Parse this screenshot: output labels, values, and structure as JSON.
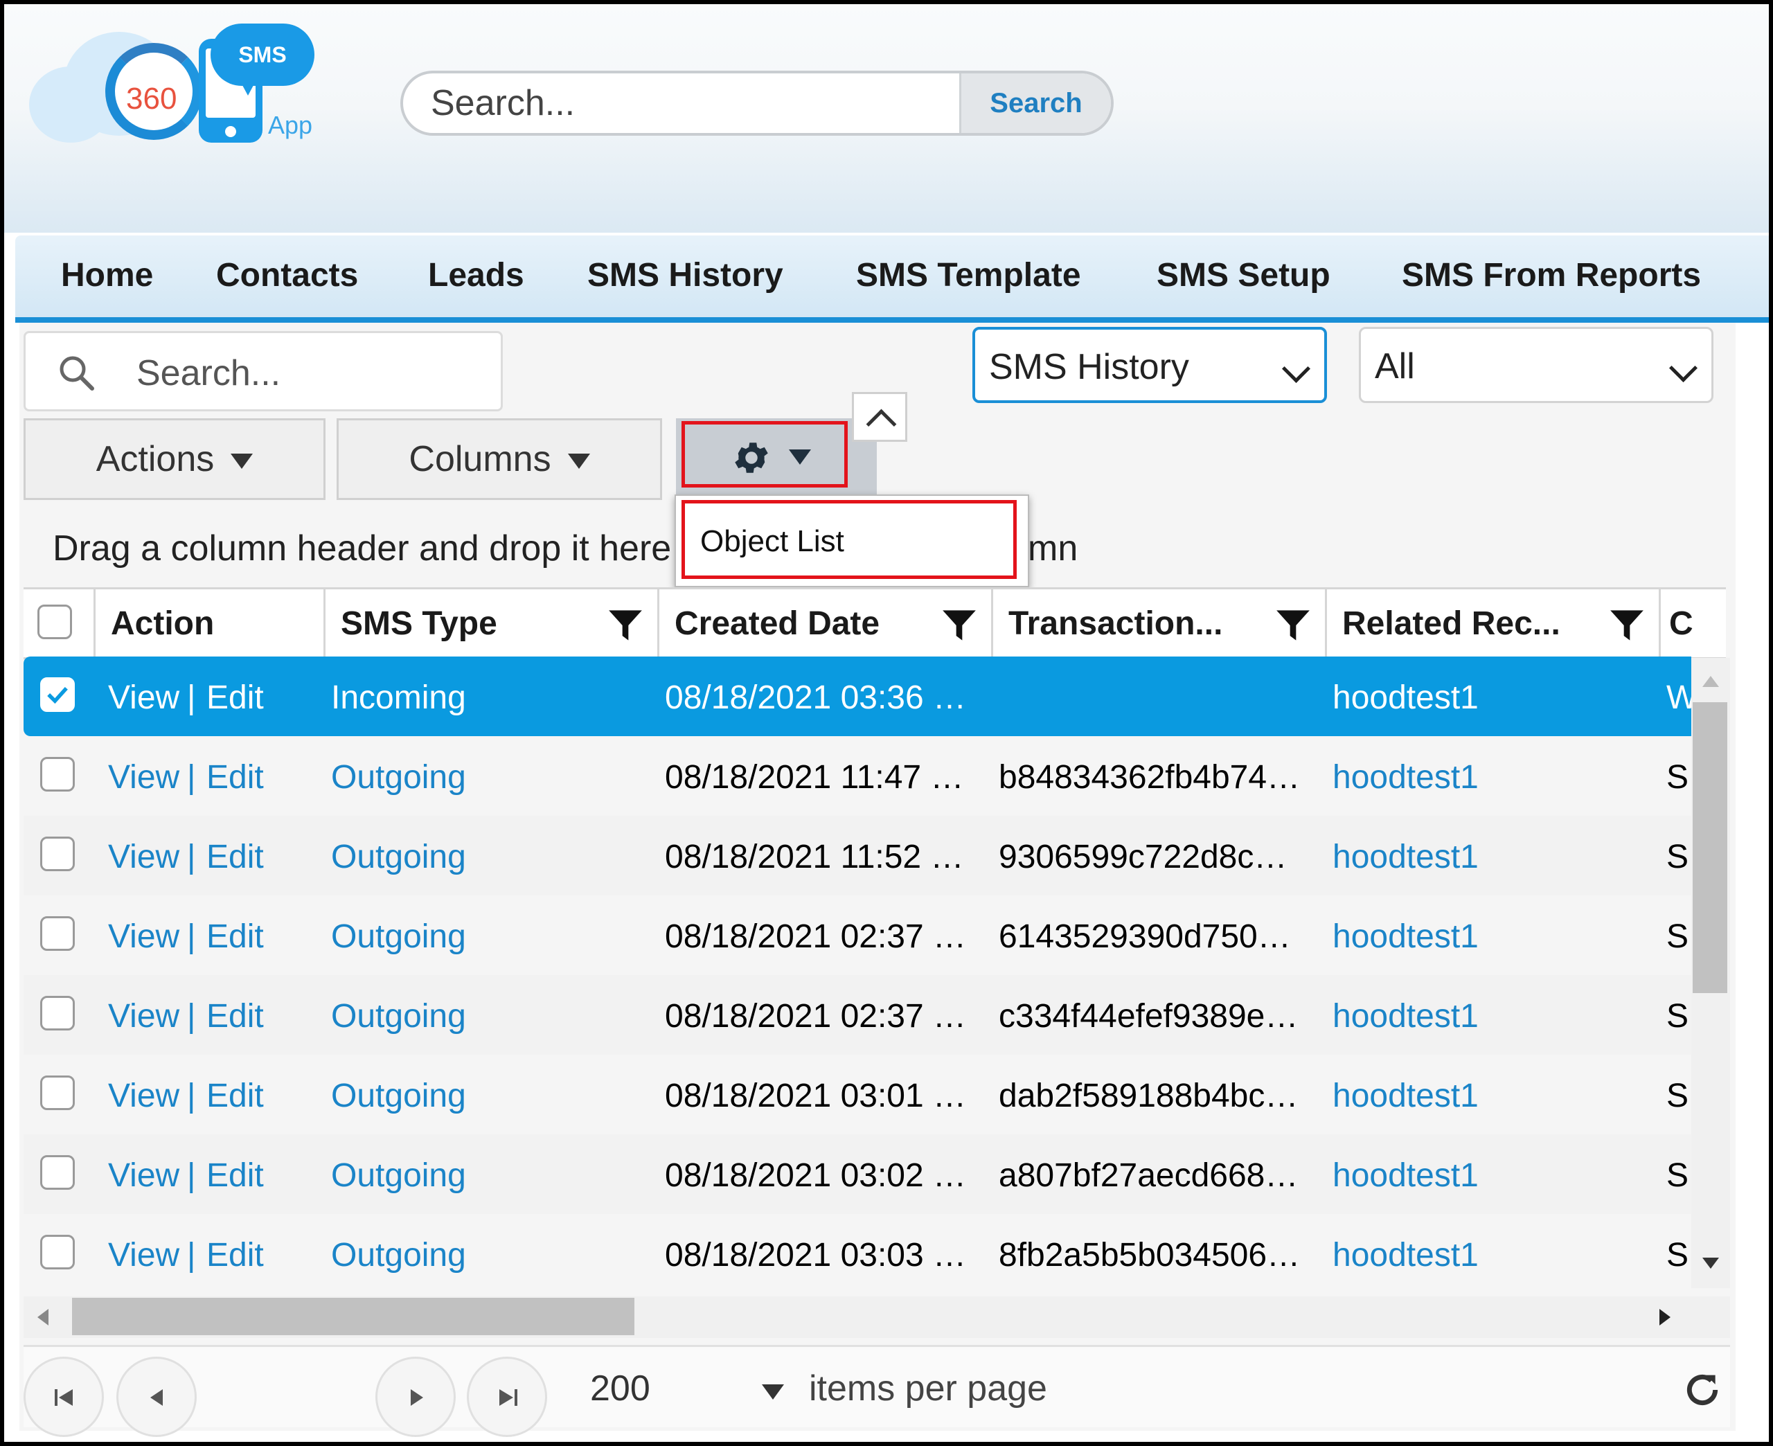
{
  "brand": {
    "bubble_text": "SMS",
    "badge_text": "360",
    "app_text": "App"
  },
  "global_search": {
    "placeholder": "Search...",
    "button_label": "Search"
  },
  "nav_tabs": [
    "Home",
    "Contacts",
    "Leads",
    "SMS History",
    "SMS Template",
    "SMS Setup",
    "SMS From Reports"
  ],
  "list_search": {
    "placeholder": "Search..."
  },
  "object_select": {
    "value": "SMS History"
  },
  "filter_select": {
    "value": "All"
  },
  "toolbar": {
    "actions_label": "Actions",
    "columns_label": "Columns"
  },
  "settings_menu": {
    "items": [
      "Object List"
    ]
  },
  "group_hint": {
    "before": "Drag a column header and drop it here",
    "after": "mn"
  },
  "columns": [
    "Action",
    "SMS Type",
    "Created Date",
    "Transaction...",
    "Related Rec...",
    "C"
  ],
  "rows": [
    {
      "view": "View",
      "edit": "Edit",
      "type": "Incoming",
      "created": "08/18/2021 03:36 …",
      "transaction": "",
      "related": "hoodtest1",
      "extra": "W",
      "selected": true
    },
    {
      "view": "View",
      "edit": "Edit",
      "type": "Outgoing",
      "created": "08/18/2021 11:47 …",
      "transaction": "b84834362fb4b74…",
      "related": "hoodtest1",
      "extra": "S",
      "selected": false
    },
    {
      "view": "View",
      "edit": "Edit",
      "type": "Outgoing",
      "created": "08/18/2021 11:52 …",
      "transaction": "9306599c722d8c…",
      "related": "hoodtest1",
      "extra": "S",
      "selected": false
    },
    {
      "view": "View",
      "edit": "Edit",
      "type": "Outgoing",
      "created": "08/18/2021 02:37 …",
      "transaction": "6143529390d750…",
      "related": "hoodtest1",
      "extra": "S",
      "selected": false
    },
    {
      "view": "View",
      "edit": "Edit",
      "type": "Outgoing",
      "created": "08/18/2021 02:37 …",
      "transaction": "c334f44efef9389e…",
      "related": "hoodtest1",
      "extra": "S",
      "selected": false
    },
    {
      "view": "View",
      "edit": "Edit",
      "type": "Outgoing",
      "created": "08/18/2021 03:01 …",
      "transaction": "dab2f589188b4bc…",
      "related": "hoodtest1",
      "extra": "S",
      "selected": false
    },
    {
      "view": "View",
      "edit": "Edit",
      "type": "Outgoing",
      "created": "08/18/2021 03:02 …",
      "transaction": "a807bf27aecd668…",
      "related": "hoodtest1",
      "extra": "S",
      "selected": false
    },
    {
      "view": "View",
      "edit": "Edit",
      "type": "Outgoing",
      "created": "08/18/2021 03:03 …",
      "transaction": "8fb2a5b5b034506…",
      "related": "hoodtest1",
      "extra": "S",
      "selected": false
    }
  ],
  "row_separator": "|",
  "pager": {
    "page_size": "200",
    "items_per_page_label": "items per page"
  },
  "colors": {
    "accent": "#0a9ae0",
    "link": "#1a84c8",
    "highlight_border": "#e3131b",
    "tab_underline": "#1a8fd6"
  }
}
